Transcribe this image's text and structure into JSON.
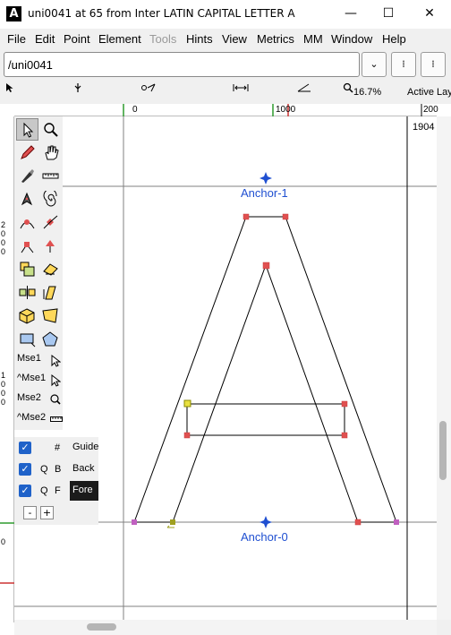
{
  "window": {
    "app_icon_glyph": "A",
    "title": "uni0041 at 65 from Inter LATIN CAPITAL LETTER A",
    "minimize": "—",
    "maximize": "☐",
    "close": "✕"
  },
  "menu": {
    "file": "File",
    "edit": "Edit",
    "point": "Point",
    "element": "Element",
    "tools": "Tools",
    "hints": "Hints",
    "view": "View",
    "metrics": "Metrics",
    "mm": "MM",
    "window": "Window",
    "help": "Help"
  },
  "namebar": {
    "glyph_name": "/uni0041",
    "dropdown_glyph": "⌄",
    "prev_glyph": "⁞",
    "next_glyph": "⁞"
  },
  "infobar": {
    "zoom": "16.7%",
    "active_layer": "Active Lay"
  },
  "rulers": {
    "h_0": "0",
    "h_1000": "1000",
    "h_2000": "200",
    "v_upper": [
      "2",
      "0",
      "0",
      "0"
    ],
    "v_middle": [
      "1",
      "0",
      "0",
      "0"
    ],
    "v_zero": "0"
  },
  "canvas": {
    "advance_width": "1904",
    "anchor_top": "Anchor-1",
    "anchor_bottom": "Anchor-0"
  },
  "toolbox": {
    "mse1": "Mse1",
    "ctrl_mse1": "^Mse1",
    "mse2": "Mse2",
    "ctrl_mse2": "^Mse2"
  },
  "layers": {
    "rows": [
      {
        "check": "✓",
        "q": "",
        "sym": "#",
        "name": "Guide"
      },
      {
        "check": "✓",
        "q": "Q",
        "sym": "B",
        "name": "Back"
      },
      {
        "check": "✓",
        "q": "Q",
        "sym": "F",
        "name": "Fore"
      }
    ],
    "remove": "-",
    "add": "+"
  },
  "colors": {
    "anchor": "#1f4fd1",
    "point": "#e05050",
    "guide_green": "#2e9a2e",
    "layer_check": "#1f62c9"
  }
}
